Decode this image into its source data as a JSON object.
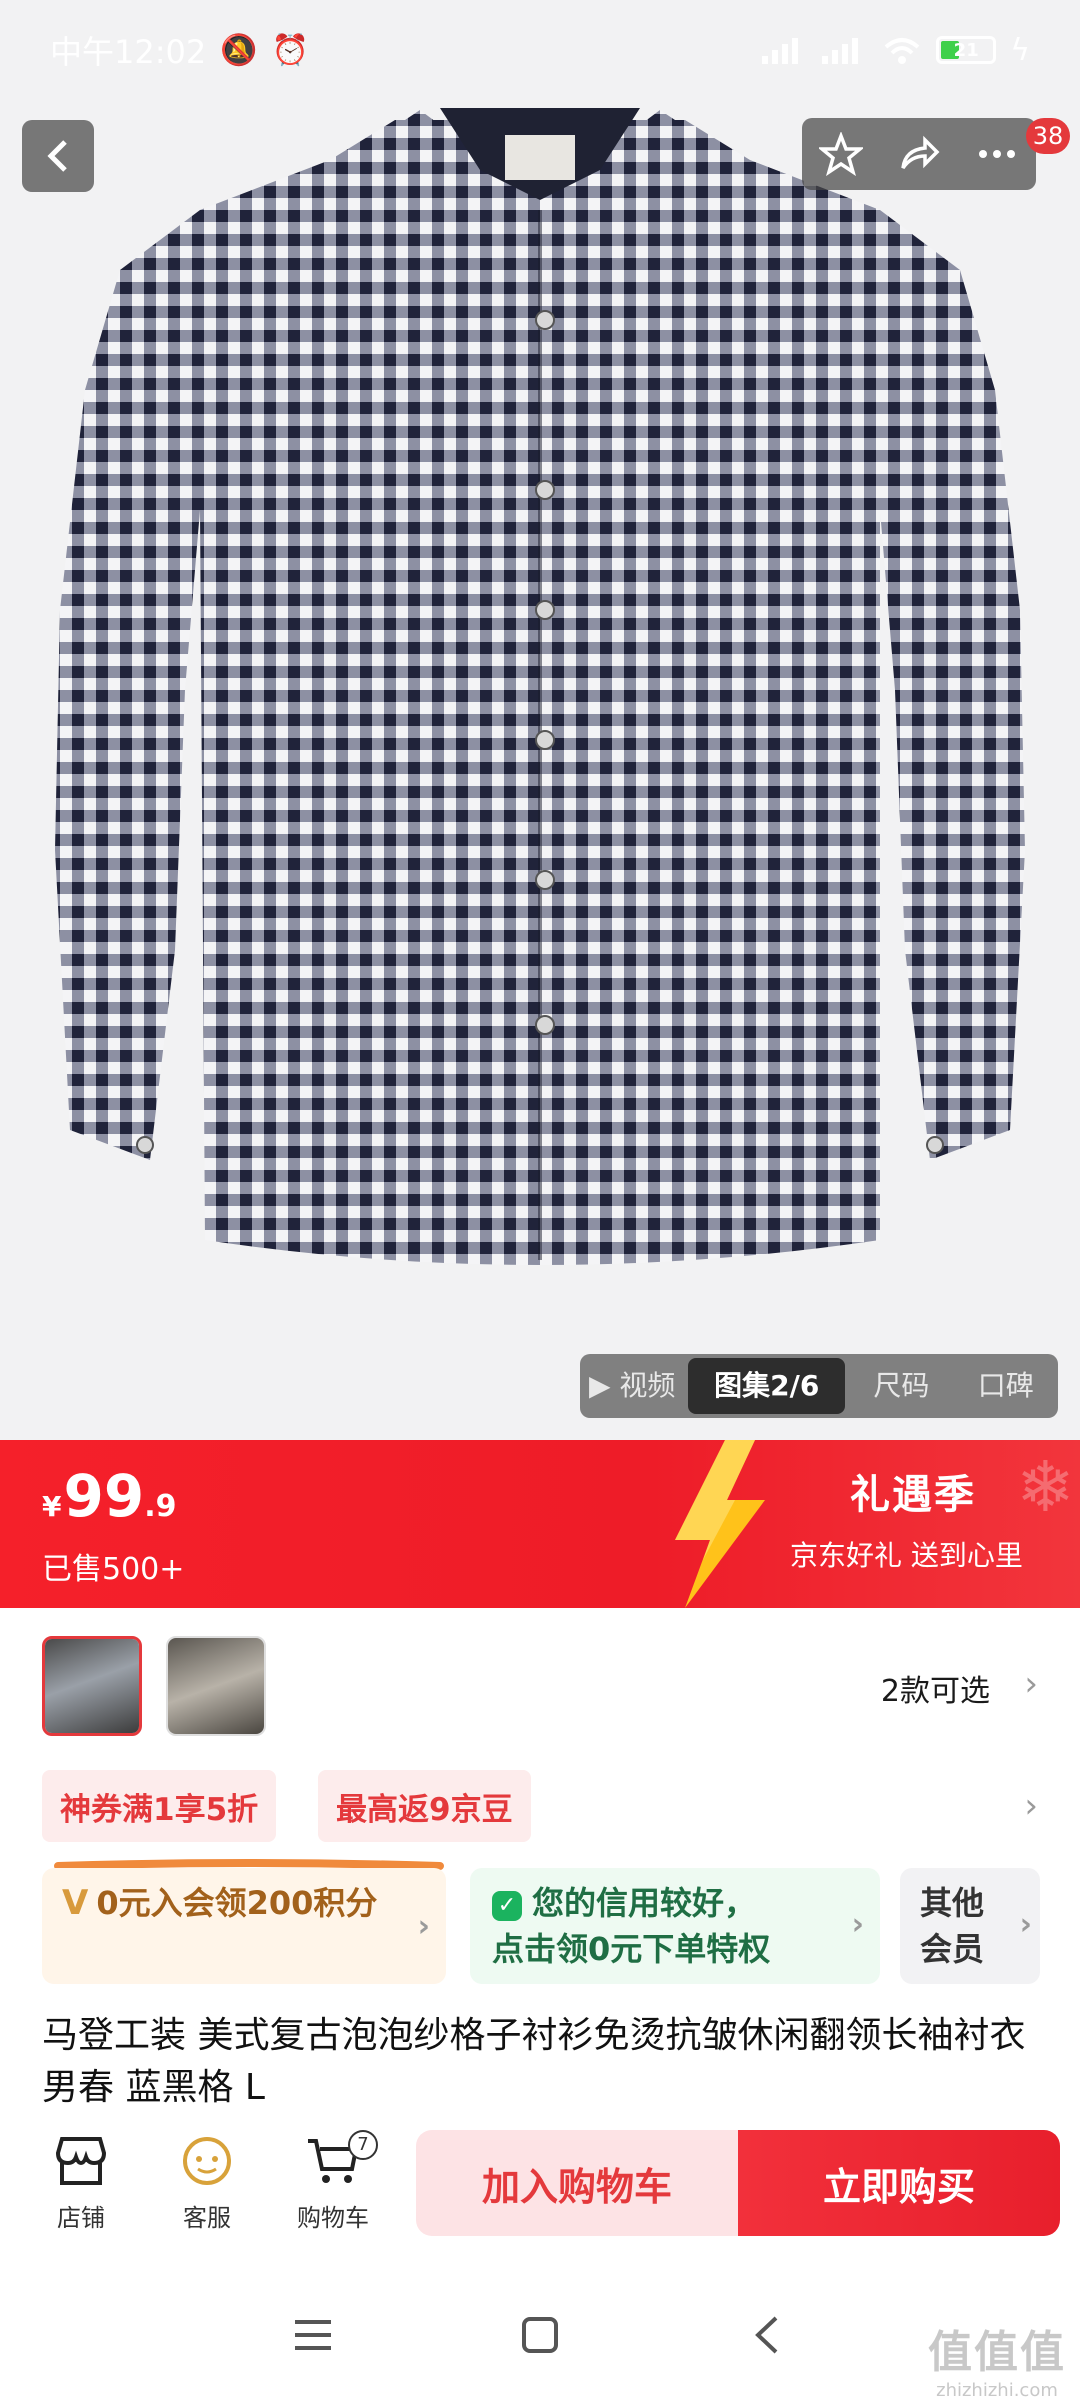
{
  "status_bar": {
    "time": "中午12:02",
    "battery": "21"
  },
  "top_actions": {
    "badge_count": "38"
  },
  "media_tabs": [
    {
      "label": "▶ 视频"
    },
    {
      "label": "图集2/6"
    },
    {
      "label": "尺码"
    },
    {
      "label": "口碑"
    }
  ],
  "price": {
    "currency": "¥",
    "integer": "99",
    "decimal": ".9",
    "sold": "已售500+"
  },
  "promo": {
    "title": "礼遇季",
    "subtitle": "京东好礼 送到心里"
  },
  "variants": {
    "count_label": "2款可选"
  },
  "coupons": [
    {
      "label": "神券满1享5折"
    },
    {
      "label": "最高返9京豆"
    }
  ],
  "member_cards": {
    "card1": "0元入会领200积分",
    "card2_line1": "您的信用较好，",
    "card2_line2": "点击领0元下单特权",
    "card3_line1": "其他",
    "card3_line2": "会员"
  },
  "product": {
    "title": "马登工装 美式复古泡泡纱格子衬衫免烫抗皱休闲翻领长袖衬衣男春 蓝黑格 L"
  },
  "bottom_bar": {
    "shop": "店铺",
    "service": "客服",
    "cart": "购物车",
    "cart_count": "7",
    "add_to_cart": "加入购物车",
    "buy_now": "立即购买"
  },
  "watermark": {
    "main": "值值值",
    "domain": "zhizhizhi.com"
  },
  "colors": {
    "brand_red": "#e4393c",
    "banner_red": "#f5202a",
    "member_gold": "#a2611b",
    "member_green": "#1f6e44"
  }
}
